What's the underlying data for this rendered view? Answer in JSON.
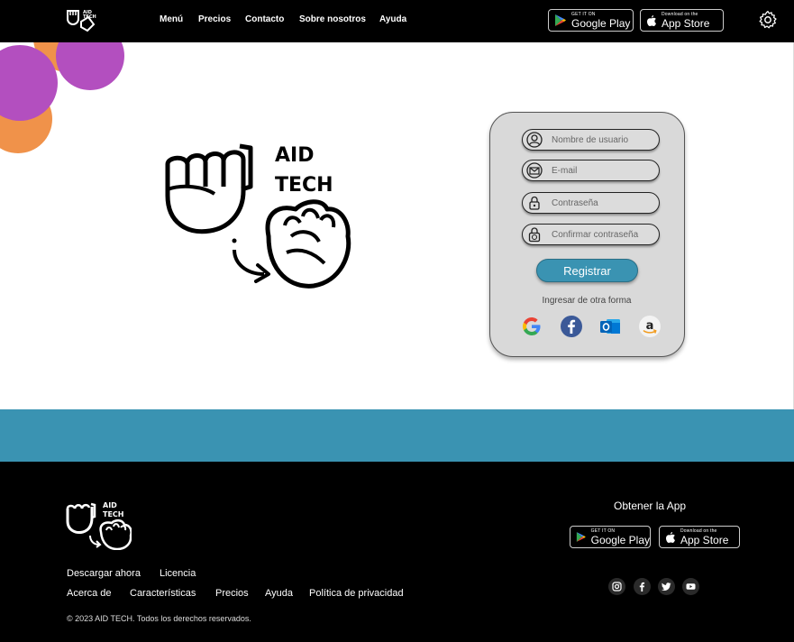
{
  "nav": {
    "items": [
      {
        "label": "Menú"
      },
      {
        "label": "Precios"
      },
      {
        "label": "Contacto"
      },
      {
        "label": "Sobre nosotros"
      },
      {
        "label": "Ayuda"
      }
    ]
  },
  "stores": {
    "google": {
      "small": "GET IT ON",
      "big": "Google Play"
    },
    "apple": {
      "small": "Download on the",
      "big": "App Store"
    }
  },
  "brand": {
    "line1": "AID",
    "line2": "TECH"
  },
  "form": {
    "username_placeholder": "Nombre de usuario",
    "email_placeholder": "E-mail",
    "password_placeholder": "Contraseña",
    "confirm_placeholder": "Confirmar contraseña",
    "register_label": "Registrar",
    "alt_login": "Ingresar de otra forma",
    "social": [
      "google-icon",
      "facebook-icon",
      "outlook-icon",
      "amazon-icon"
    ]
  },
  "footer": {
    "links_row1": [
      "Descargar ahora",
      "Licencia"
    ],
    "links_row2": [
      "Acerca de",
      "Características",
      "Precios",
      "Ayuda",
      "Política de privacidad"
    ],
    "copyright": "© 2023 AID TECH. Todos los derechos reservados.",
    "get_app": "Obtener la App",
    "social": [
      "instagram-icon",
      "facebook-icon",
      "twitter-icon",
      "youtube-icon"
    ]
  },
  "colors": {
    "accent": "#3a93b2",
    "blob_purple": "#b34fbf",
    "blob_orange": "#f0924a",
    "card_bg": "#d9d9d9"
  }
}
